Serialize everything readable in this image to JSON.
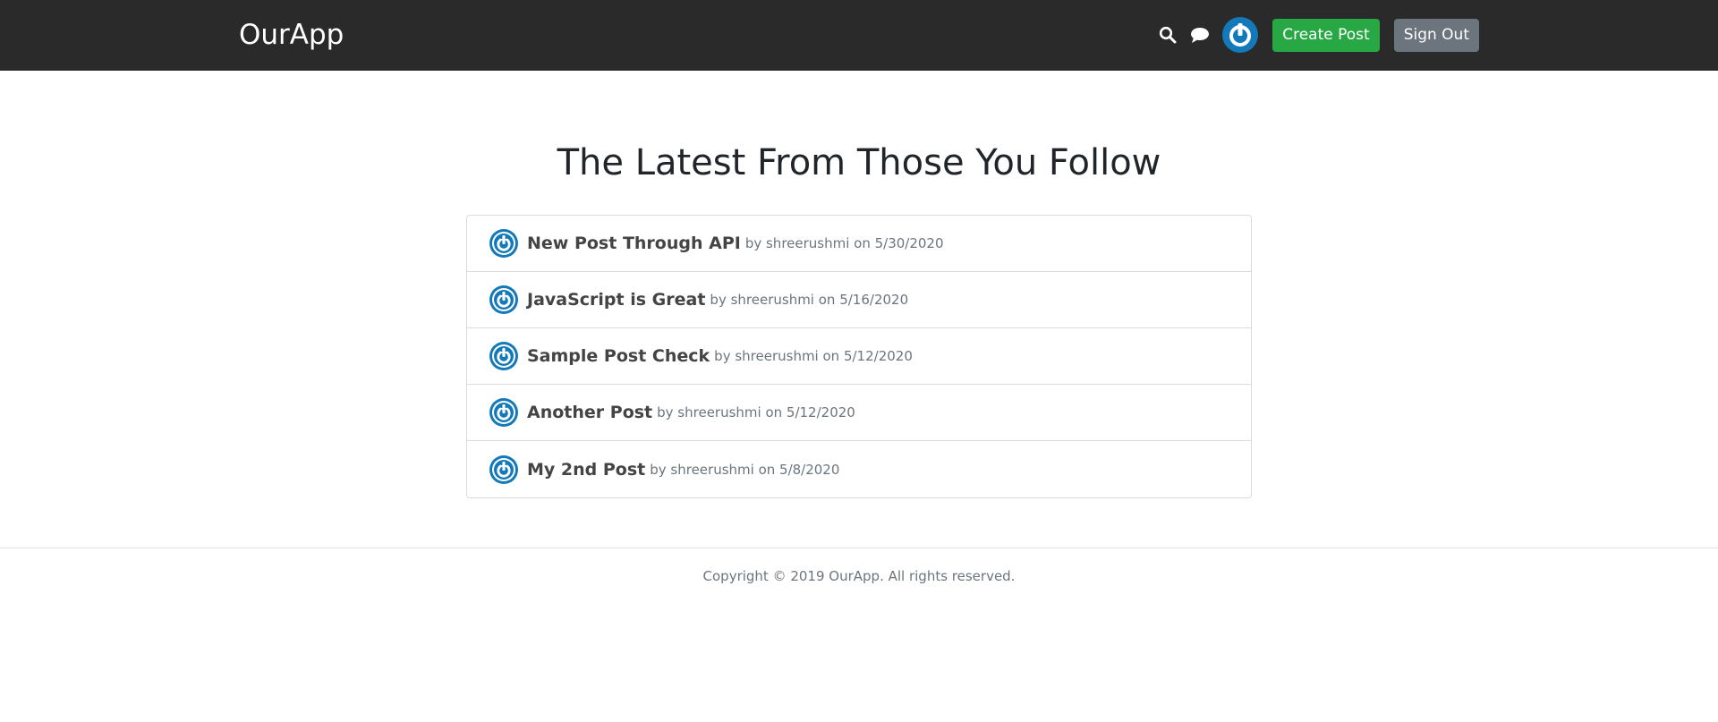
{
  "navbar": {
    "brand": "OurApp",
    "icons": [
      "search-icon",
      "chat-icon",
      "avatar"
    ],
    "create_post_label": "Create Post",
    "sign_out_label": "Sign Out",
    "create_color": "#28a745",
    "signout_color": "#6c757d",
    "background": "#2a2a2a"
  },
  "main": {
    "title": "The Latest From Those You Follow",
    "posts": [
      {
        "title": "New Post Through API",
        "meta": "by shreerushmi on 5/30/2020"
      },
      {
        "title": "JavaScript is Great",
        "meta": "by shreerushmi on 5/16/2020"
      },
      {
        "title": "Sample Post Check",
        "meta": "by shreerushmi on 5/12/2020"
      },
      {
        "title": "Another Post",
        "meta": "by shreerushmi on 5/12/2020"
      },
      {
        "title": "My 2nd Post",
        "meta": "by shreerushmi on 5/8/2020"
      }
    ]
  },
  "footer": {
    "text": "Copyright © 2019 OurApp. All rights reserved."
  },
  "colors": {
    "avatar_blue": "#1479b8",
    "avatar_ring": "#0d6aa8"
  }
}
